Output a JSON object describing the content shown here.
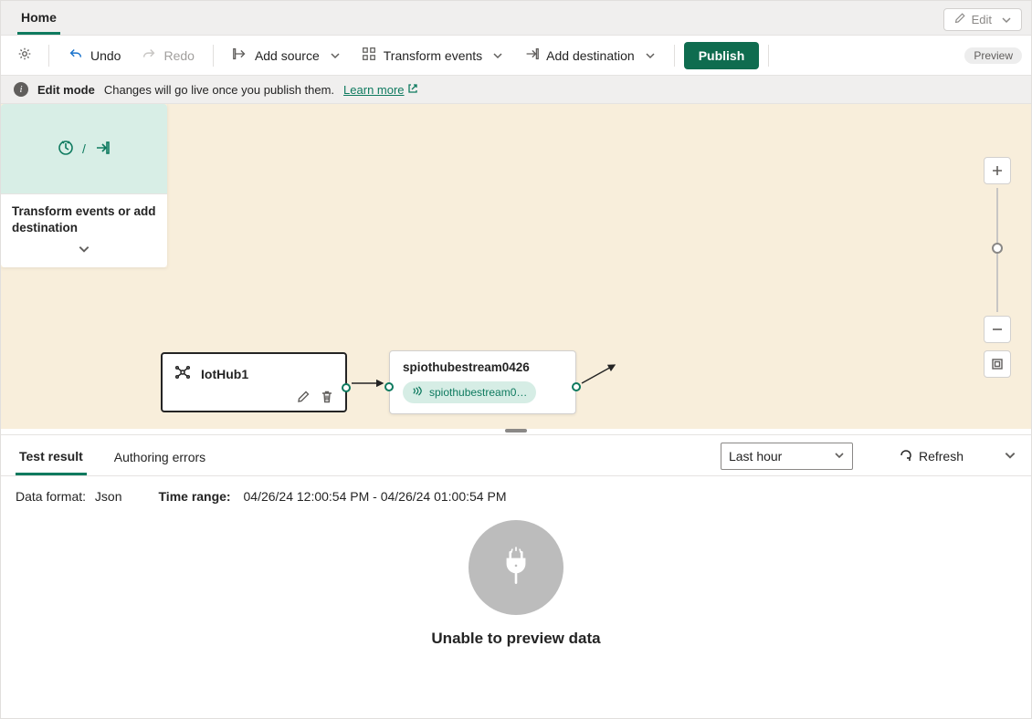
{
  "tabsRow": {
    "home": "Home",
    "editButton": "Edit"
  },
  "toolbar": {
    "undo": "Undo",
    "redo": "Redo",
    "addSource": "Add source",
    "transformEvents": "Transform events",
    "addDestination": "Add destination",
    "publish": "Publish",
    "preview": "Preview"
  },
  "editBar": {
    "title": "Edit mode",
    "desc": "Changes will go live once you publish them.",
    "learnMore": "Learn more"
  },
  "nodes": {
    "iothub": "IotHub1",
    "streamTitle": "spiothubestream0426",
    "streamChip": "spiothubestream0…",
    "actionLabel": "Transform events or add destination",
    "slash": "/"
  },
  "bottomPanel": {
    "tabTestResult": "Test result",
    "tabAuthoringErrors": "Authoring errors",
    "timeDropdown": "Last hour",
    "refresh": "Refresh",
    "dataFormatLabel": "Data format:",
    "dataFormatValue": "Json",
    "timeRangeLabel": "Time range:",
    "timeRangeValue": "04/26/24 12:00:54 PM - 04/26/24 01:00:54 PM",
    "emptyMsg": "Unable to preview data"
  }
}
